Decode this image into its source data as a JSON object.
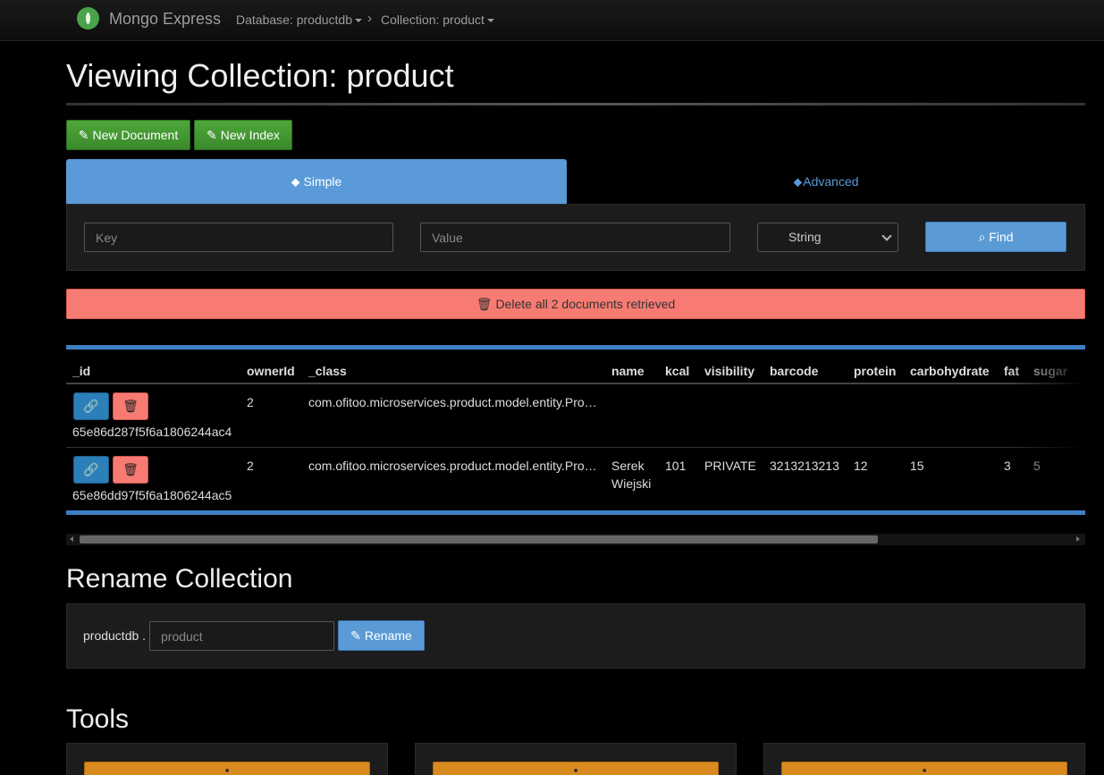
{
  "navbar": {
    "brand": "Mongo Express",
    "database_label": "Database: productdb",
    "collection_label": "Collection: product"
  },
  "page_title": "Viewing Collection: product",
  "actions": {
    "new_document": "New Document",
    "new_index": "New Index"
  },
  "tabs": {
    "simple": "Simple",
    "advanced": "Advanced"
  },
  "search": {
    "key_placeholder": "Key",
    "value_placeholder": "Value",
    "type_selected": "String",
    "find_label": "Find"
  },
  "delete_all_label": "Delete all 2 documents retrieved",
  "table": {
    "columns": [
      "_id",
      "ownerId",
      "_class",
      "name",
      "kcal",
      "visibility",
      "barcode",
      "protein",
      "carbohydrate",
      "fat",
      "sugar"
    ],
    "rows": [
      {
        "_id": "65e86d287f5f6a1806244ac4",
        "ownerId": "2",
        "_class": "com.ofitoo.microservices.product.model.entity.Pro…",
        "name_line1": "",
        "name_line2": "",
        "kcal": "",
        "visibility": "",
        "barcode": "",
        "protein": "",
        "carbohydrate": "",
        "fat": "",
        "sugar": ""
      },
      {
        "_id": "65e86dd97f5f6a1806244ac5",
        "ownerId": "2",
        "_class": "com.ofitoo.microservices.product.model.entity.Pro…",
        "name_line1": "Serek",
        "name_line2": "Wiejski",
        "kcal": "101",
        "visibility": "PRIVATE",
        "barcode": "3213213213",
        "protein": "12",
        "carbohydrate": "15",
        "fat": "3",
        "sugar": "5"
      }
    ]
  },
  "rename": {
    "heading": "Rename Collection",
    "db_prefix": "productdb .",
    "input_placeholder": "product",
    "button_label": "Rename"
  },
  "tools": {
    "heading": "Tools"
  },
  "icons": {
    "brand": "mongo-leaf-icon",
    "chevron": "chevron-right-icon",
    "pencil": "pencil-icon",
    "tag": "tag-icon",
    "tags": "tags-icon",
    "search": "search-icon",
    "trash": "trash-icon",
    "link": "link-icon",
    "save": "save-icon"
  },
  "colors": {
    "accent_blue": "#5a9ad8",
    "green": "#4ea73b",
    "danger": "#f87b73",
    "warning": "#d98a1e"
  }
}
